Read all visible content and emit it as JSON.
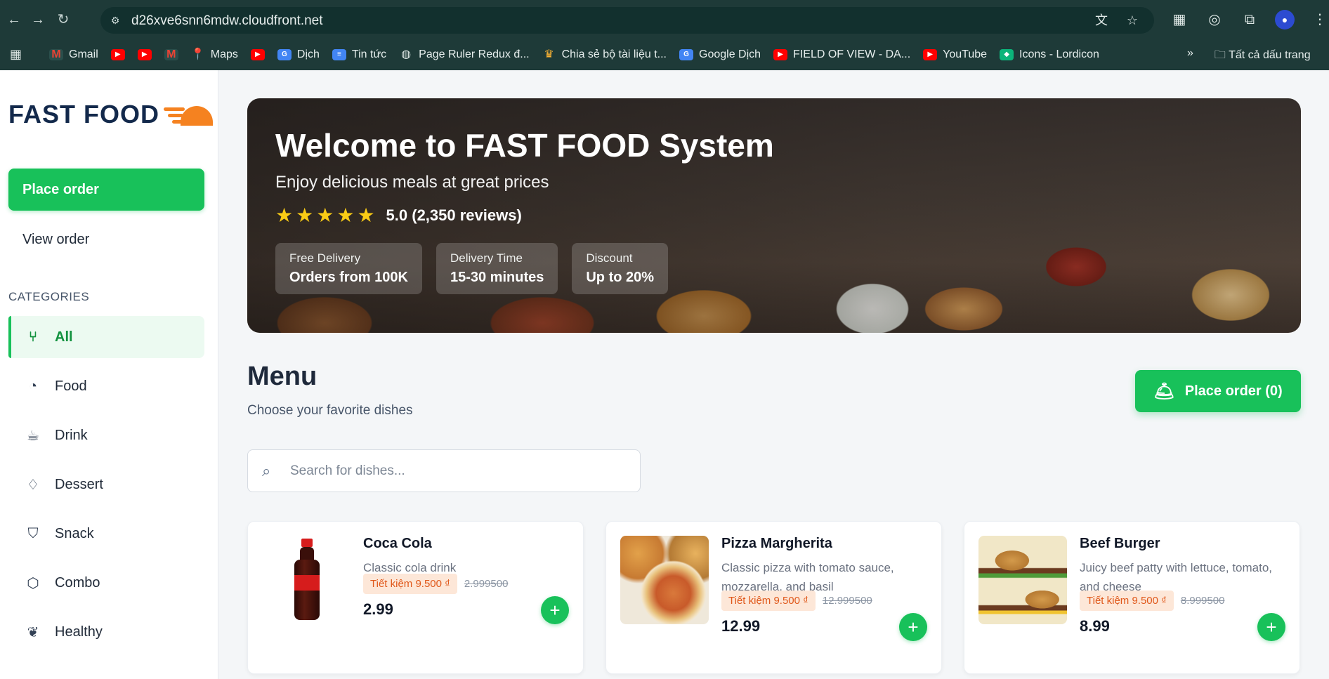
{
  "browser": {
    "url": "d26xve6snn6mdw.cloudfront.net",
    "bookmarks": [
      {
        "label": "Gmail",
        "icon": "gmail-icon"
      },
      {
        "label": "",
        "icon": "youtube-icon"
      },
      {
        "label": "",
        "icon": "youtube-icon"
      },
      {
        "label": "",
        "icon": "gmail-icon"
      },
      {
        "label": "Maps",
        "icon": "maps-icon"
      },
      {
        "label": "",
        "icon": "youtube-icon"
      },
      {
        "label": "Dịch",
        "icon": "translate-icon"
      },
      {
        "label": "Tin tức",
        "icon": "news-icon"
      },
      {
        "label": "Page Ruler Redux đ...",
        "icon": "globe-icon"
      },
      {
        "label": "Chia sẻ bộ tài liệu t...",
        "icon": "crown-icon"
      },
      {
        "label": "Google Dịch",
        "icon": "translate-icon"
      },
      {
        "label": "FIELD OF VIEW - DA...",
        "icon": "youtube-icon"
      },
      {
        "label": "YouTube",
        "icon": "youtube-icon"
      },
      {
        "label": "Icons - Lordicon",
        "icon": "lordicon-icon"
      }
    ],
    "bookmarks_overflow": "»",
    "all_bookmarks": "Tất cả dấu trang"
  },
  "sidebar": {
    "logo": "FAST FOOD",
    "place_order": "Place order",
    "view_order": "View order",
    "categories_title": "CATEGORIES",
    "categories": [
      {
        "label": "All",
        "icon": "fork-knife-icon",
        "active": true
      },
      {
        "label": "Food",
        "icon": "cookie-icon",
        "active": false
      },
      {
        "label": "Drink",
        "icon": "coffee-cup-icon",
        "active": false
      },
      {
        "label": "Dessert",
        "icon": "ice-cream-icon",
        "active": false
      },
      {
        "label": "Snack",
        "icon": "popcorn-icon",
        "active": false
      },
      {
        "label": "Combo",
        "icon": "box-icon",
        "active": false
      },
      {
        "label": "Healthy",
        "icon": "leaf-icon",
        "active": false
      }
    ]
  },
  "hero": {
    "title": "Welcome to FAST FOOD System",
    "subtitle": "Enjoy delicious meals at great prices",
    "stars": 5,
    "rating": "5.0 (2,350 reviews)",
    "badges": [
      {
        "label": "Free Delivery",
        "value": "Orders from 100K"
      },
      {
        "label": "Delivery Time",
        "value": "15-30 minutes"
      },
      {
        "label": "Discount",
        "value": "Up to 20%"
      }
    ]
  },
  "menu": {
    "title": "Menu",
    "subtitle": "Choose your favorite dishes",
    "cart_button": "Place order (0)",
    "search_placeholder": "Search for dishes...",
    "items": [
      {
        "name": "Coca Cola",
        "description": "Classic cola drink",
        "saving": "Tiết kiệm 9.500 ₫",
        "old_price": "2.999500",
        "price": "2.99"
      },
      {
        "name": "Pizza Margherita",
        "description": "Classic pizza with tomato sauce, mozzarella, and basil",
        "saving": "Tiết kiệm 9.500 ₫",
        "old_price": "12.999500",
        "price": "12.99"
      },
      {
        "name": "Beef Burger",
        "description": "Juicy beef patty with lettuce, tomato, and cheese",
        "saving": "Tiết kiệm 9.500 ₫",
        "old_price": "8.999500",
        "price": "8.99"
      }
    ]
  },
  "colors": {
    "accent_green": "#18c15a",
    "logo_navy": "#13294b",
    "logo_orange": "#f58220",
    "saving_text": "#e0581a"
  }
}
